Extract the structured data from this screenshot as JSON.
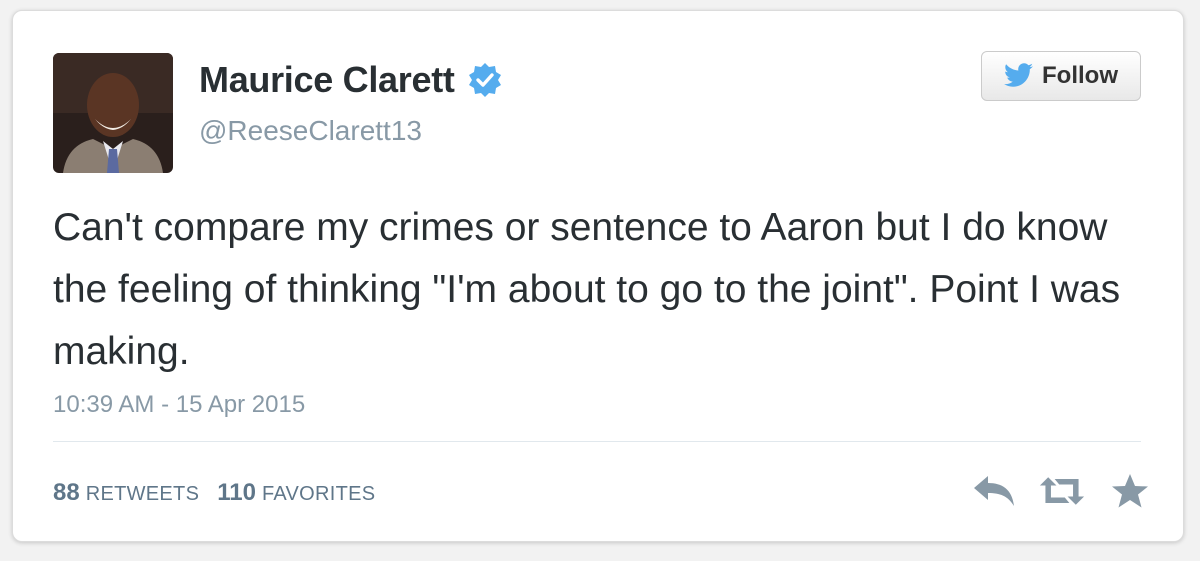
{
  "user": {
    "display_name": "Maurice Clarett",
    "handle": "@ReeseClarett13",
    "verified": true
  },
  "follow_button": {
    "label": "Follow"
  },
  "tweet": {
    "text": "Can't compare my crimes or sentence to Aaron but I do know the feeling of thinking \"I'm about to go to the joint\". Point I was making.",
    "timestamp": "10:39 AM - 15 Apr 2015"
  },
  "stats": {
    "retweets_count": "88",
    "retweets_label": "RETWEETS",
    "favorites_count": "110",
    "favorites_label": "FAVORITES"
  },
  "actions": {
    "icons": [
      "reply-icon",
      "retweet-icon",
      "favorite-icon"
    ]
  },
  "colors": {
    "verified": "#55acee",
    "twitter_bird": "#55acee",
    "text": "#292f33",
    "muted": "#8899a6",
    "action_icon": "#8899a6"
  }
}
